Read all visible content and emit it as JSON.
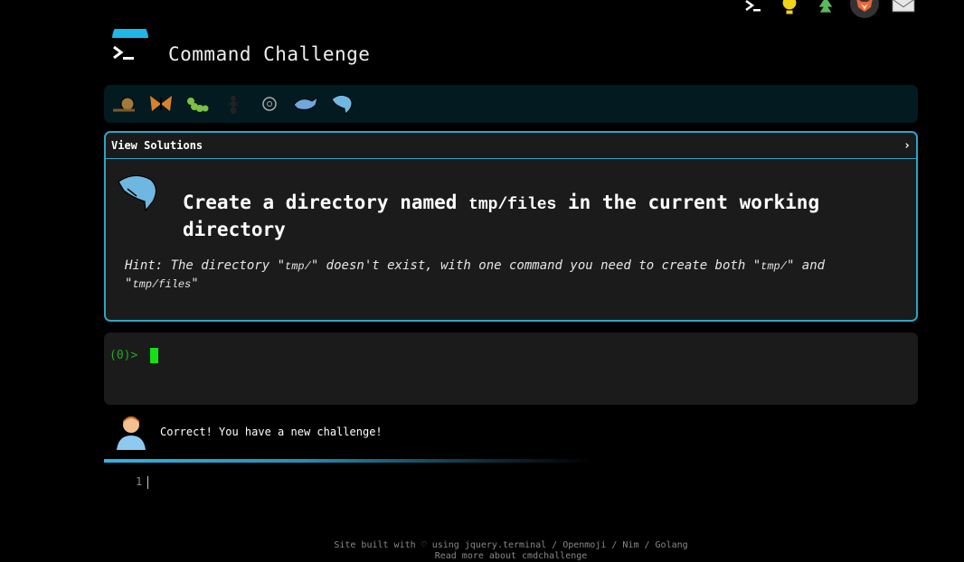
{
  "header": {
    "title": "Command Challenge",
    "top_icons": [
      "terminal-icon",
      "lightbulb-icon",
      "tree-icon",
      "fox-icon",
      "envelope-icon"
    ]
  },
  "levels": [
    "snail-icon",
    "butterfly-icon",
    "caterpillar-icon",
    "ant-icon",
    "microbe-icon",
    "whale-icon",
    "dolphin-icon"
  ],
  "challenge": {
    "solutions_label": "View Solutions",
    "chevron": "›",
    "prompt_prefix": "Create a directory named ",
    "prompt_code": "tmp/files",
    "prompt_suffix": " in the current working directory",
    "hint_1": "Hint: The directory \"",
    "hint_code_1": "tmp/",
    "hint_2": "\" doesn't exist, with one command you need to create both \"",
    "hint_code_2": "tmp/",
    "hint_3": "\" and \"",
    "hint_code_3": "tmp/files",
    "hint_4": "\""
  },
  "terminal": {
    "prompt": "(0)> "
  },
  "feedback": {
    "message": "Correct! You have a new challenge!"
  },
  "editor": {
    "line_number": "1"
  },
  "footer": {
    "line1": "Site built with ♡ using jquery.terminal / Openmoji / Nim / Golang",
    "line2": "Read more about cmdchallenge"
  },
  "colors": {
    "accent": "#2fa3c4",
    "prompt_green": "#1faa1f",
    "cursor_green": "#14e014"
  }
}
